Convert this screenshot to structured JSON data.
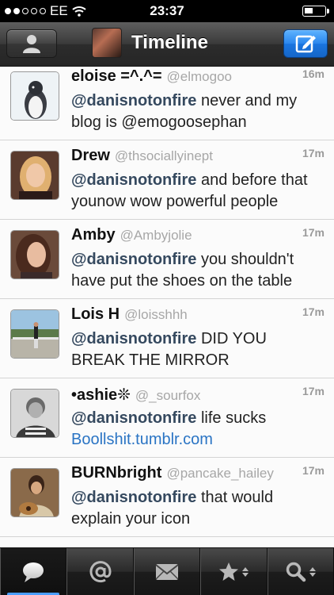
{
  "status_bar": {
    "carrier": "EE",
    "time": "23:37"
  },
  "navbar": {
    "title": "Timeline"
  },
  "tweets": [
    {
      "name": "eloise =^.^=",
      "handle": "@elmogoo",
      "time": "16m",
      "mention": "@danisnotonfire",
      "text": " never and my blog is @emogoosephan",
      "link": ""
    },
    {
      "name": "Drew",
      "handle": "@thsociallyinept",
      "time": "17m",
      "mention": "@danisnotonfire",
      "text": " and before that younow wow powerful people",
      "link": ""
    },
    {
      "name": "Amby",
      "handle": "@Ambyjolie",
      "time": "17m",
      "mention": "@danisnotonfire",
      "text": " you shouldn't have put the shoes on the table",
      "link": ""
    },
    {
      "name": "Lois H",
      "handle": "@loisshhh",
      "time": "17m",
      "mention": "@danisnotonfire",
      "text": " DID YOU BREAK THE MIRROR",
      "link": ""
    },
    {
      "name": "•ashie❊",
      "handle": "@_sourfox",
      "time": "17m",
      "mention": "@danisnotonfire",
      "text": " life sucks",
      "link": "Boollshit.tumblr.com"
    },
    {
      "name": "BURNbright",
      "handle": "@pancake_hailey",
      "time": "17m",
      "mention": "@danisnotonfire",
      "text": " that would explain your icon",
      "link": ""
    },
    {
      "name": "",
      "handle": "",
      "time": "",
      "mention": "",
      "text": "",
      "link": ""
    }
  ],
  "tabs": [
    {
      "icon": "speech-bubble-icon",
      "active": true
    },
    {
      "icon": "at-sign-icon",
      "active": false
    },
    {
      "icon": "envelope-icon",
      "active": false
    },
    {
      "icon": "star-icon",
      "active": false
    },
    {
      "icon": "search-icon",
      "active": false
    }
  ],
  "colors": {
    "mention": "#35495f",
    "link": "#2a74c4",
    "handle": "#a7a7a7",
    "tab_indicator": "#4a9eff",
    "compose_button": "#2a86ee"
  }
}
